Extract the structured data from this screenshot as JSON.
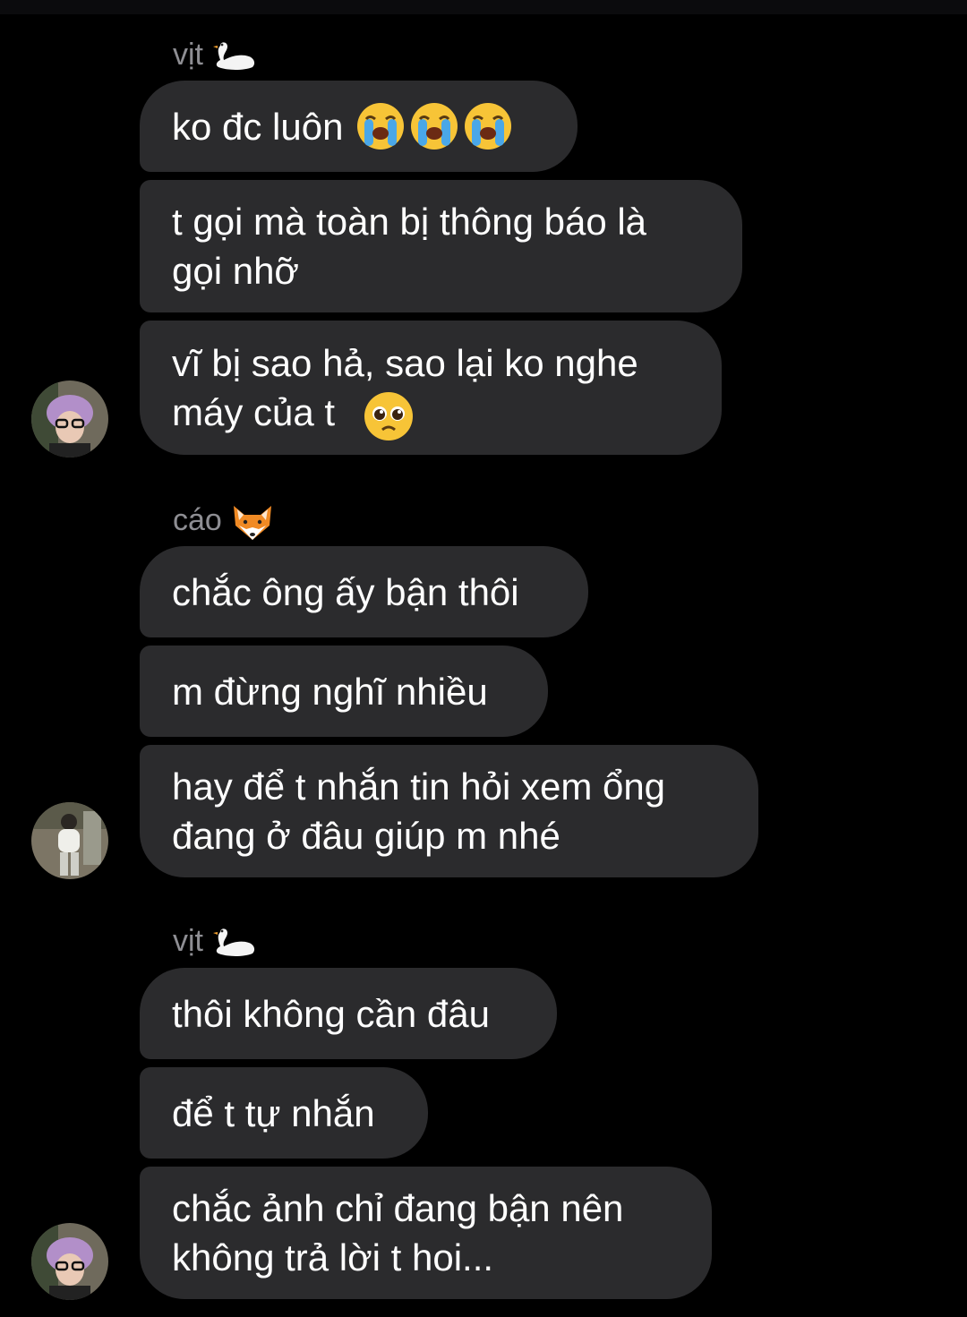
{
  "groups": [
    {
      "sender": "vịt",
      "sender_icon": "swan-icon",
      "messages": [
        "ko đc luôn",
        "t gọi mà toàn bị thông báo là\ngọi nhỡ",
        "vĩ bị sao hả, sao lại ko nghe\nmáy của t"
      ],
      "emojis": [
        "loudly-crying-face-icon",
        "pleading-face-icon"
      ]
    },
    {
      "sender": "cáo",
      "sender_icon": "fox-icon",
      "messages": [
        "chắc ông ấy bận thôi",
        "m đừng nghĩ nhiều",
        "hay để t nhắn tin hỏi xem ổng\nđang ở đâu giúp m nhé"
      ]
    },
    {
      "sender": "vịt",
      "sender_icon": "swan-icon",
      "messages": [
        "thôi không cần đâu",
        "để t tự nhắn",
        "chắc ảnh chỉ đang bận nên\nkhông trả lời t hoi..."
      ]
    }
  ],
  "colors": {
    "background": "#000000",
    "bubble": "#2b2b2d",
    "sender_name": "#8e8e93",
    "text": "#ffffff"
  }
}
